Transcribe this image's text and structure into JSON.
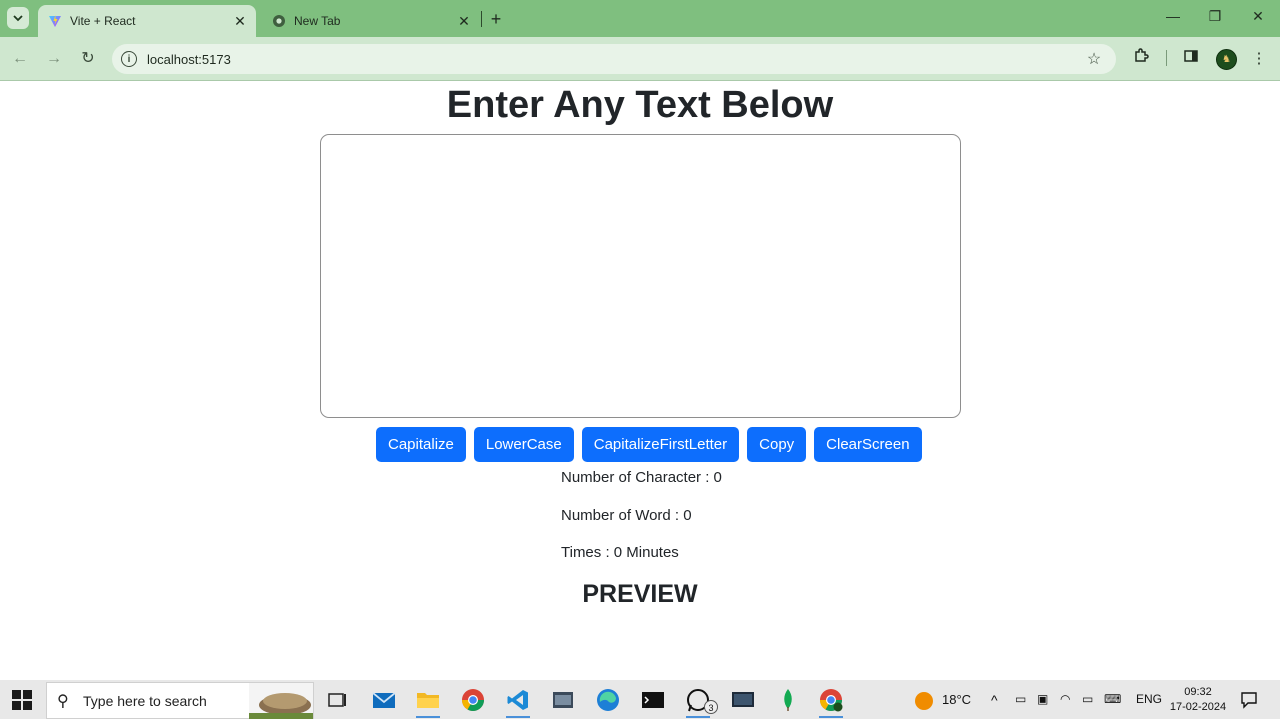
{
  "browser": {
    "tabs": [
      {
        "title": "Vite + React",
        "favicon": "vite-icon",
        "active": true
      },
      {
        "title": "New Tab",
        "favicon": "chrome-icon",
        "active": false
      }
    ],
    "url": "localhost:5173"
  },
  "page": {
    "heading": "Enter Any Text Below",
    "textarea_value": "",
    "buttons": [
      "Capitalize",
      "LowerCase",
      "CapitalizeFirstLetter",
      "Copy",
      "ClearScreen"
    ],
    "stats": {
      "characters": "Number of Character : 0",
      "words": "Number of Word : 0",
      "time": "Times : 0 Minutes"
    },
    "preview_heading": "PREVIEW"
  },
  "taskbar": {
    "search_placeholder": "Type here to search",
    "whatsapp_badge": "3",
    "weather": "18°C",
    "language": "ENG",
    "time": "09:32",
    "date": "17-02-2024"
  },
  "colors": {
    "chrome_tabstrip": "#7fbf7f",
    "chrome_toolbar": "#cfe7cf",
    "button_primary": "#0d6efd"
  }
}
